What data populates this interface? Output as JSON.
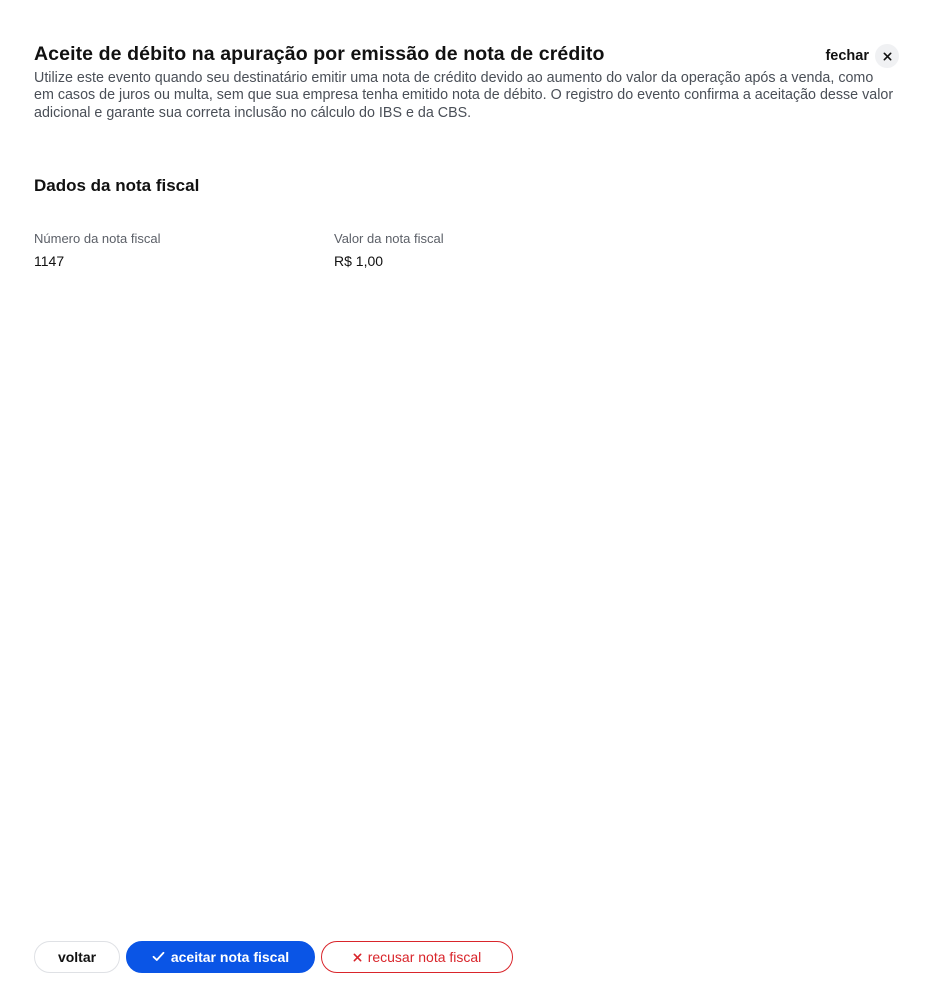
{
  "header": {
    "title": "Aceite de débito na apuração por emissão de nota de crédito",
    "close_label": "fechar",
    "description": "Utilize este evento quando seu destinatário emitir uma nota de crédito devido ao aumento do valor da operação após a venda, como em casos de juros ou multa, sem que sua empresa tenha emitido nota de débito. O registro do evento confirma a aceitação desse valor adicional e garante sua correta inclusão no cálculo do IBS e da CBS."
  },
  "invoice_section": {
    "title": "Dados da nota fiscal",
    "fields": [
      {
        "label": "Número da nota fiscal",
        "value": "1147"
      },
      {
        "label": "Valor da nota fiscal",
        "value": "R$ 1,00"
      }
    ]
  },
  "footer": {
    "back_label": "voltar",
    "accept_label": "aceitar nota fiscal",
    "accept_icon": "check-icon",
    "refuse_label": "recusar nota fiscal",
    "refuse_icon": "x-icon"
  },
  "colors": {
    "accent": "#0a55e6",
    "danger": "#d9252b",
    "text": "#111111",
    "muted": "#4a4f57"
  }
}
